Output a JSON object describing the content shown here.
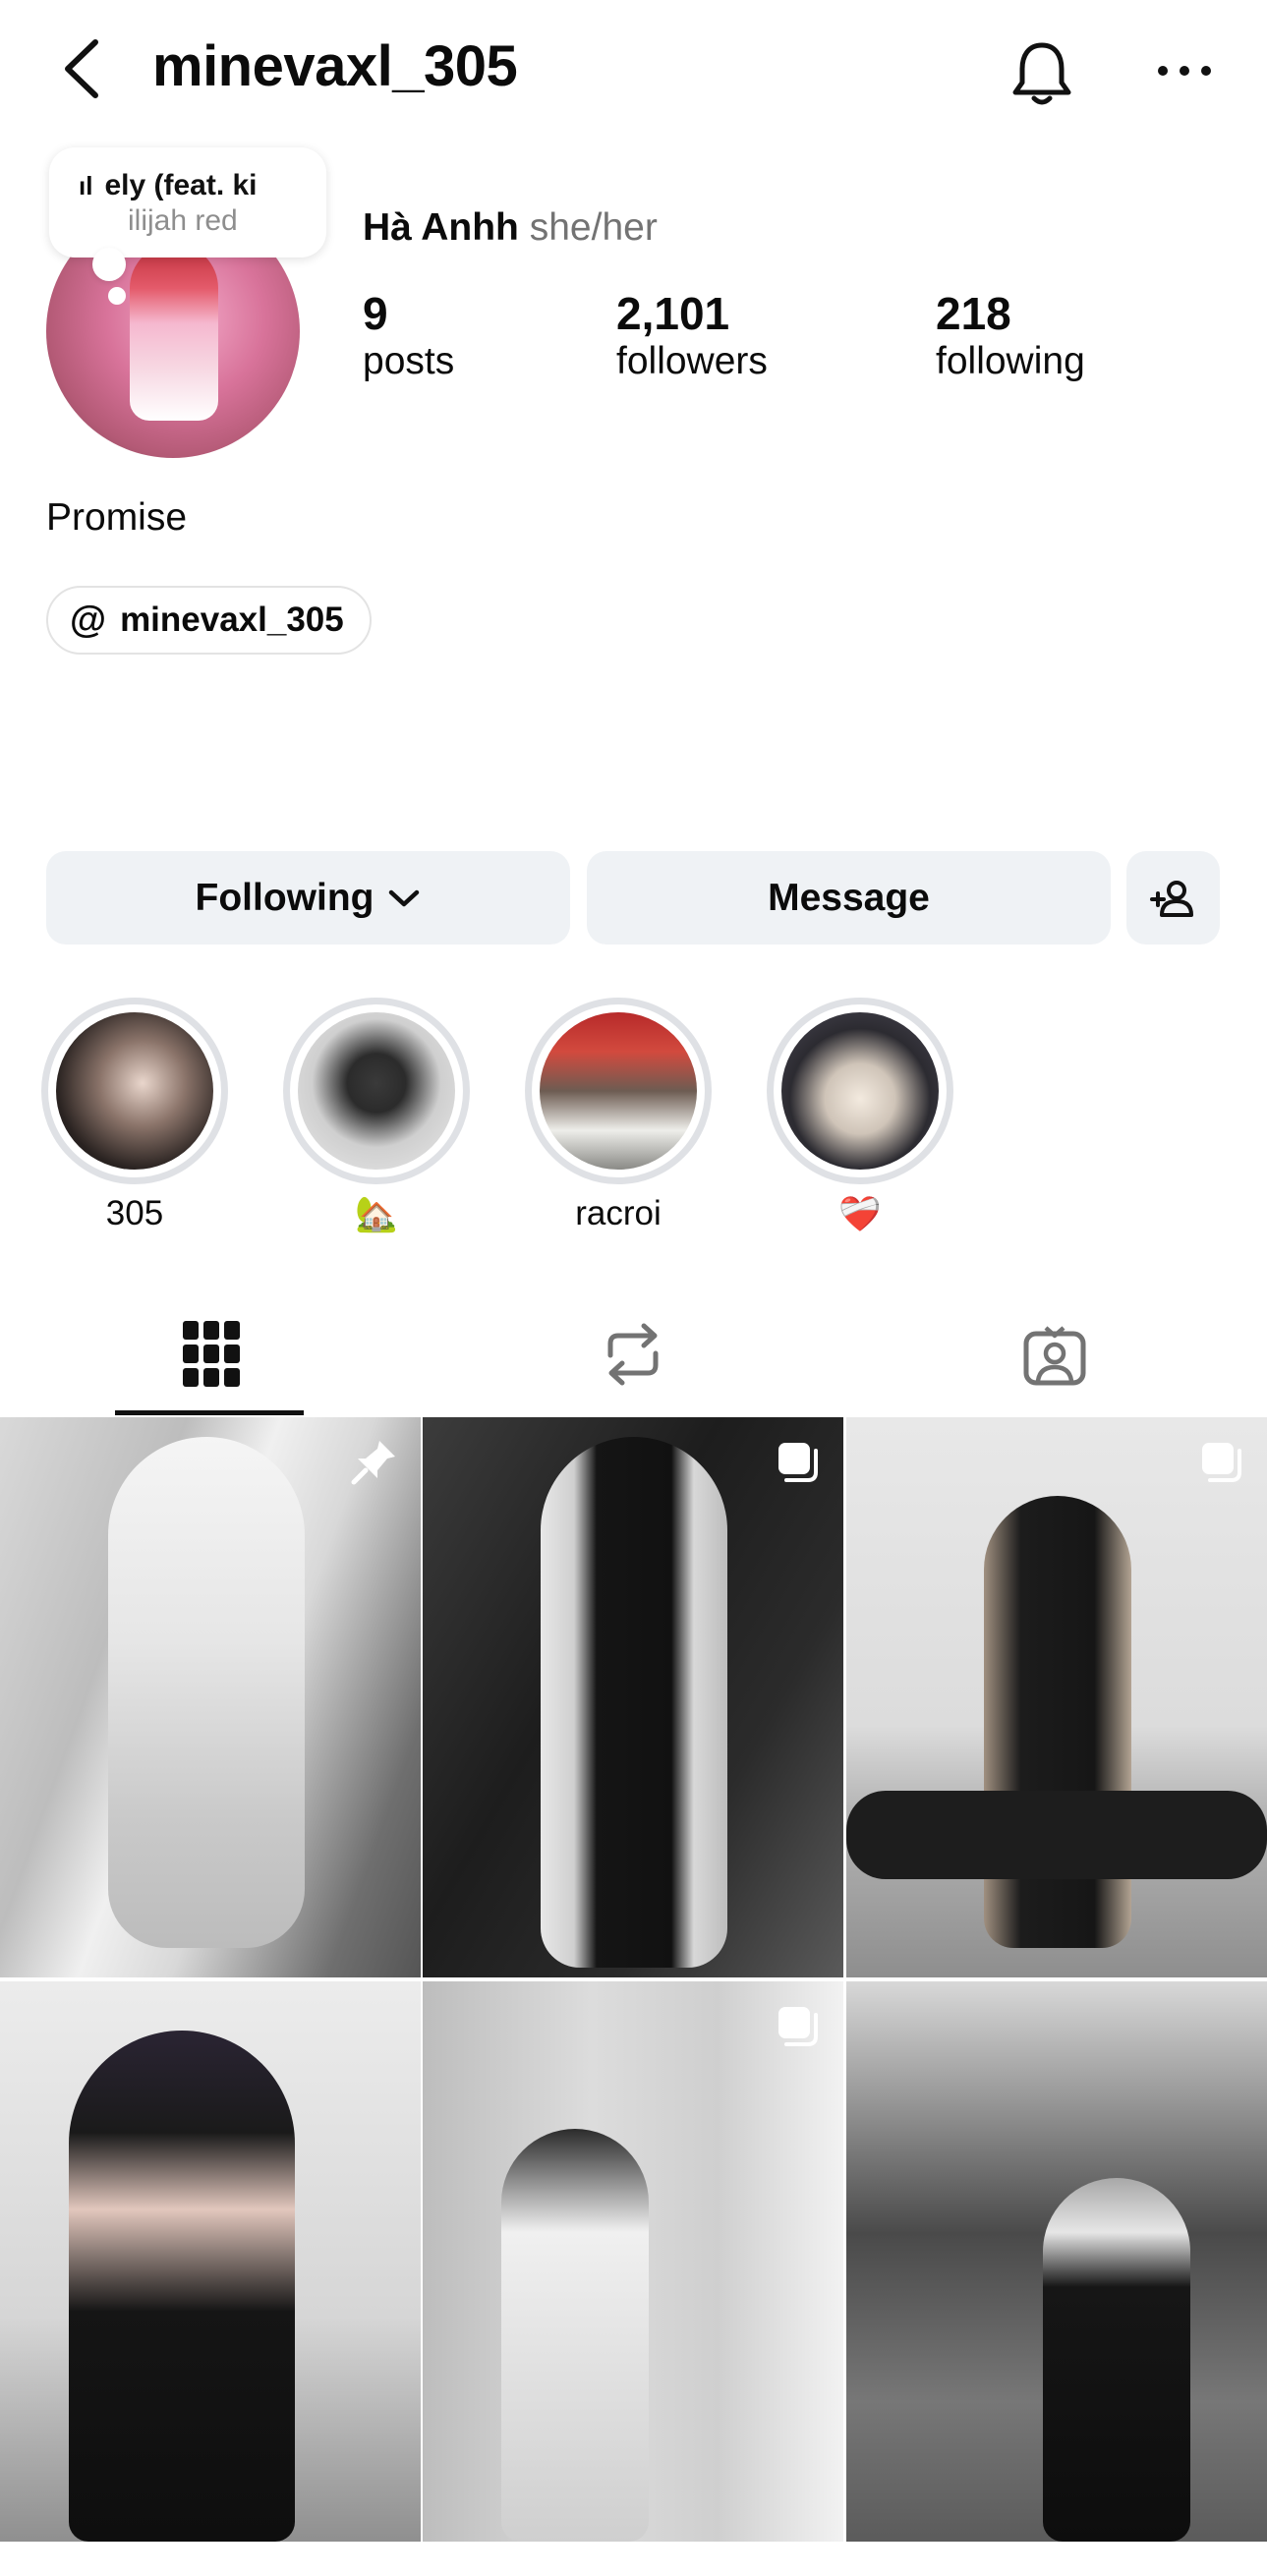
{
  "header": {
    "username": "minevaxl_305"
  },
  "note": {
    "song": "ely (feat. ki",
    "artist": "ilijah red"
  },
  "profile": {
    "display_name": "Hà Anhh",
    "pronouns": "she/her",
    "bio": "Promise",
    "threads_handle": "minevaxl_305"
  },
  "stats": [
    {
      "value": "9",
      "label": "posts"
    },
    {
      "value": "2,101",
      "label": "followers"
    },
    {
      "value": "218",
      "label": "following"
    }
  ],
  "actions": {
    "following_label": "Following",
    "message_label": "Message"
  },
  "highlights": [
    {
      "label": "305"
    },
    {
      "label": "🏡"
    },
    {
      "label": "racroi"
    },
    {
      "label": "❤️‍🩹"
    }
  ],
  "tabs": [
    {
      "icon": "grid-icon",
      "active": true
    },
    {
      "icon": "reposts-icon",
      "active": false
    },
    {
      "icon": "tagged-icon",
      "active": false
    }
  ],
  "posts": [
    {
      "badge": "pin-icon",
      "tone": "light"
    },
    {
      "badge": "multi-photo-icon",
      "tone": "dark"
    },
    {
      "badge": "multi-photo-icon",
      "tone": "light"
    },
    {
      "badge": "",
      "tone": "light"
    },
    {
      "badge": "multi-photo-icon",
      "tone": "light"
    },
    {
      "badge": "",
      "tone": "mid"
    }
  ]
}
